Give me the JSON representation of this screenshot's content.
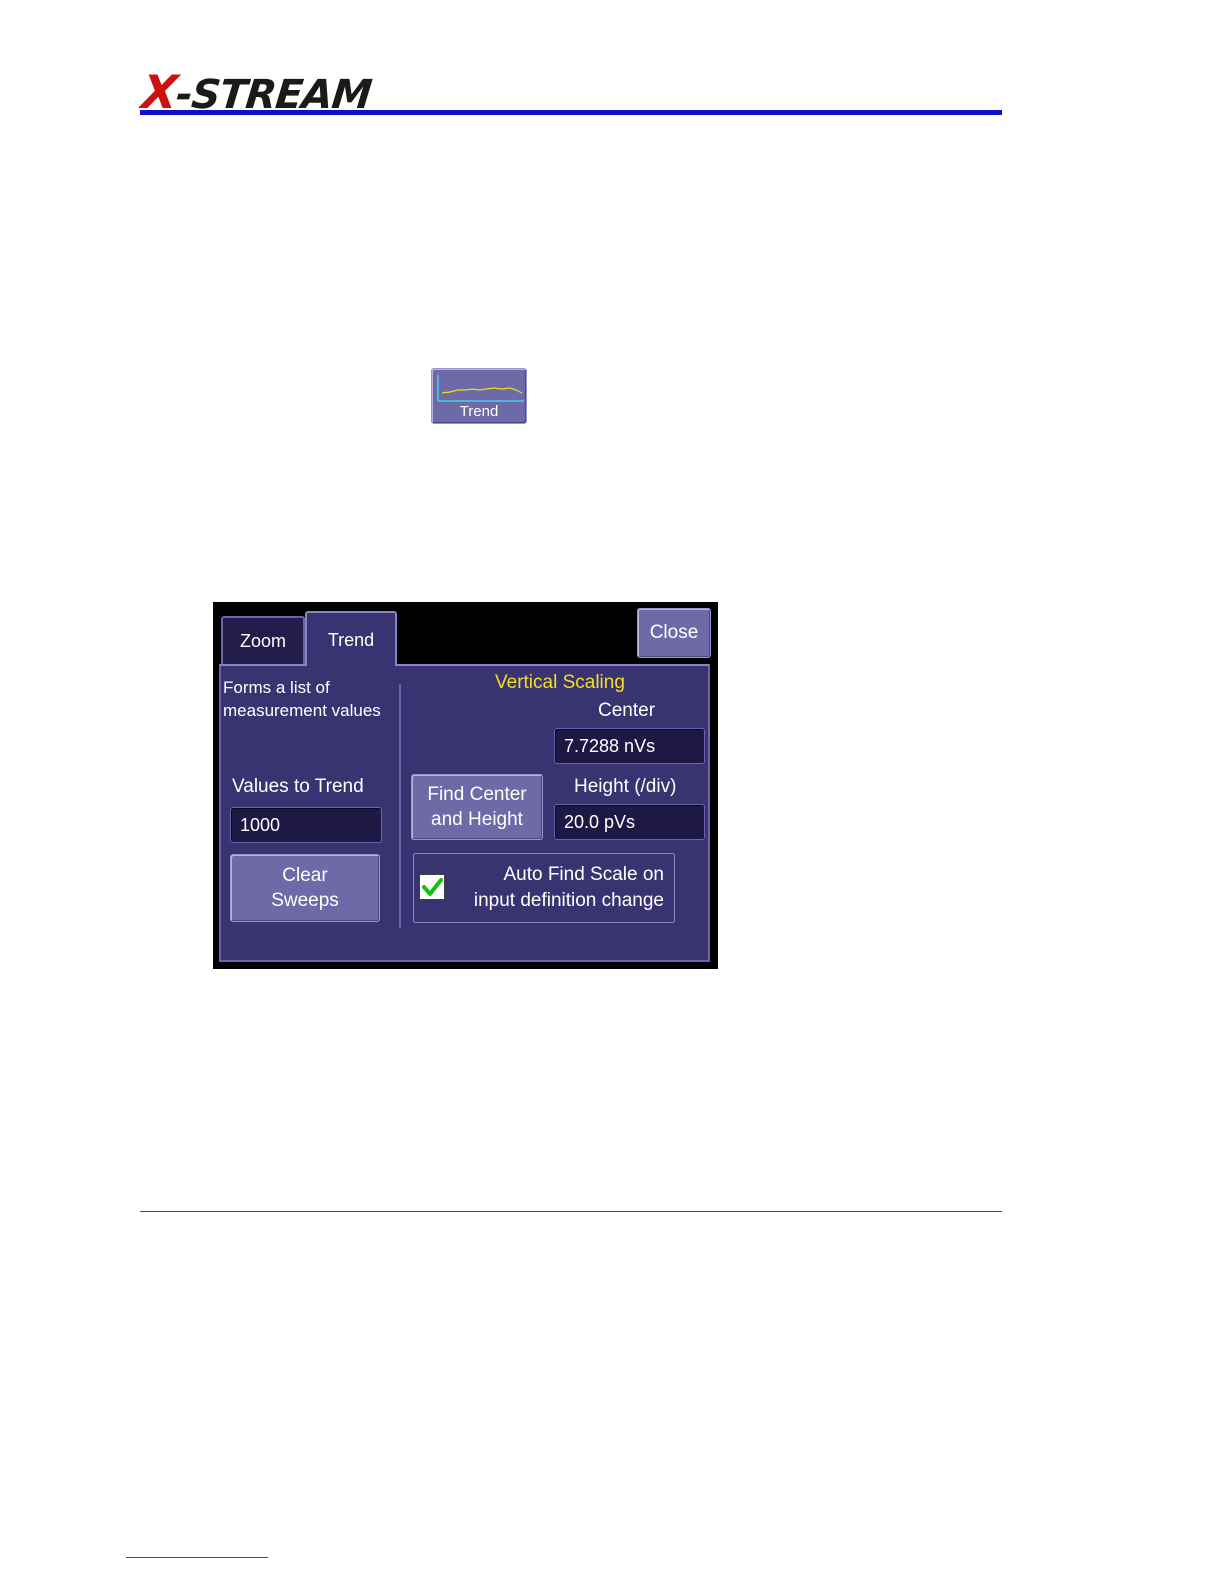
{
  "header": {
    "logo_text_x": "X",
    "logo_text_rest": "-STREAM"
  },
  "trend_icon": {
    "label": "Trend",
    "colors": {
      "trace": "#f0e020",
      "axis": "#40d0f0"
    }
  },
  "dialog": {
    "tabs": [
      {
        "label": "Zoom"
      },
      {
        "label": "Trend"
      }
    ],
    "selected_tab": "Trend",
    "close_label": "Close",
    "description": "Forms a list of\nmeasurement values",
    "values_to_trend": {
      "label": "Values to Trend",
      "value": "1000"
    },
    "clear_sweeps_label": "Clear\nSweeps",
    "vertical_scaling": {
      "title": "Vertical Scaling",
      "center_label": "Center",
      "center_value": "7.7288 nVs",
      "find_center_label": "Find Center\nand Height",
      "height_label": "Height (/div)",
      "height_value": "20.0 pVs"
    },
    "auto_find": {
      "label": "Auto Find Scale on\ninput definition change",
      "checked": true
    },
    "colors": {
      "panel": "#3a3372",
      "title": "#f0e020",
      "check": "#10c010"
    }
  }
}
